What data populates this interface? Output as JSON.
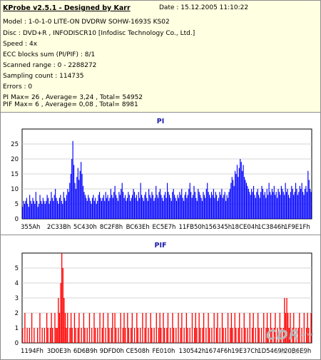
{
  "header": {
    "title": "KProbe v2.5.1 - Designed by Karr",
    "date": "Date : 15.12.2005 11:10:22",
    "lines": [
      "Model : 1-0-1-0 LITE-ON DVDRW SOHW-1693S KS02",
      "Disc : DVD+R , INFODISCR10 [Infodisc Technology Co., Ltd.]",
      "Speed : 4x",
      "ECC blocks sum (PI/PIF) : 8/1",
      "Scanned range : 0 - 2288272",
      "Sampling count : 114735",
      "Errors : 0",
      "PI Max= 26 , Average= 3,24 , Total= 54952",
      "PIF Max= 6 , Average= 0,08 , Total= 8981"
    ]
  },
  "colors": {
    "pi_bars": "#0000ff",
    "pif_bars": "#ff0000",
    "title": "#1a1aa8",
    "info_bg": "#ffffe1"
  },
  "watermark": {
    "logo": "CDR",
    "server": "server",
    "url": "www.cdr.cz"
  },
  "chart_data": [
    {
      "type": "bar",
      "title": "PI",
      "ylim": [
        0,
        30
      ],
      "yticks": [
        0,
        5,
        10,
        15,
        20,
        25
      ],
      "xtick_labels": [
        "355Ah",
        "2C33Bh",
        "5C430h",
        "8C2F8h",
        "BC63Eh",
        "EC5E7h",
        "11FB50h",
        "156345h",
        "18CE04h",
        "1C3846h",
        "1F9E1Fh"
      ],
      "grid": true,
      "series": [
        {
          "values": [
            4,
            6,
            5,
            6,
            7,
            5,
            4,
            8,
            6,
            5,
            7,
            6,
            5,
            9,
            6,
            4,
            5,
            8,
            6,
            5,
            7,
            6,
            5,
            6,
            8,
            7,
            5,
            6,
            9,
            7,
            6,
            8,
            10,
            7,
            6,
            5,
            7,
            8,
            6,
            5,
            9,
            7,
            6,
            8,
            10,
            9,
            12,
            15,
            20,
            26,
            18,
            12,
            10,
            14,
            17,
            13,
            16,
            19,
            15,
            11,
            9,
            8,
            7,
            6,
            8,
            7,
            6,
            5,
            7,
            8,
            6,
            7,
            5,
            6,
            8,
            9,
            7,
            6,
            7,
            8,
            6,
            9,
            7,
            8,
            6,
            7,
            10,
            8,
            7,
            9,
            11,
            8,
            7,
            6,
            9,
            8,
            10,
            12,
            9,
            7,
            8,
            6,
            7,
            9,
            8,
            6,
            7,
            8,
            10,
            9,
            7,
            8,
            6,
            9,
            7,
            12,
            8,
            7,
            6,
            8,
            9,
            7,
            6,
            10,
            8,
            7,
            9,
            8,
            6,
            7,
            11,
            8,
            7,
            9,
            10,
            8,
            7,
            6,
            8,
            9,
            7,
            12,
            9,
            8,
            7,
            6,
            9,
            10,
            8,
            7,
            6,
            8,
            7,
            9,
            8,
            10,
            7,
            6,
            8,
            9,
            7,
            8,
            10,
            12,
            9,
            7,
            8,
            11,
            9,
            7,
            6,
            10,
            9,
            8,
            7,
            6,
            9,
            8,
            7,
            10,
            12,
            9,
            8,
            7,
            9,
            8,
            10,
            7,
            9,
            8,
            6,
            7,
            9,
            8,
            10,
            7,
            8,
            9,
            6,
            8,
            7,
            9,
            10,
            12,
            14,
            13,
            11,
            16,
            15,
            18,
            14,
            17,
            20,
            19,
            16,
            18,
            14,
            13,
            12,
            11,
            10,
            9,
            8,
            10,
            9,
            11,
            8,
            7,
            9,
            10,
            8,
            7,
            9,
            11,
            10,
            8,
            9,
            7,
            10,
            8,
            12,
            9,
            8,
            10,
            9,
            11,
            8,
            9,
            7,
            10,
            9,
            8,
            11,
            10,
            9,
            8,
            12,
            9,
            10,
            8,
            7,
            9,
            11,
            10,
            8,
            9,
            12,
            10,
            8,
            9,
            11,
            10,
            12,
            9,
            8,
            10,
            11,
            9,
            16,
            13,
            10,
            9
          ]
        }
      ]
    },
    {
      "type": "bar",
      "title": "PIF",
      "ylim": [
        0,
        6
      ],
      "yticks": [
        0,
        1,
        2,
        3,
        4,
        5
      ],
      "xtick_labels": [
        "1194Fh",
        "3D0E3h",
        "6D6B9h",
        "9DFD0h",
        "CE508h",
        "FE010h",
        "130542h",
        "1674F6h",
        "19E37Ch",
        "1D5469h",
        "20B6E9h"
      ],
      "grid": true,
      "series": [
        {
          "values": [
            1,
            0,
            2,
            0,
            1,
            0,
            1,
            0,
            2,
            0,
            1,
            0,
            0,
            1,
            0,
            2,
            0,
            1,
            0,
            1,
            0,
            2,
            1,
            0,
            1,
            2,
            1,
            0,
            2,
            1,
            1,
            3,
            2,
            4,
            6,
            5,
            3,
            2,
            1,
            2,
            0,
            1,
            2,
            1,
            0,
            2,
            1,
            0,
            1,
            2,
            0,
            1,
            0,
            2,
            1,
            0,
            1,
            0,
            2,
            0,
            1,
            0,
            2,
            1,
            0,
            1,
            0,
            2,
            0,
            1,
            2,
            0,
            1,
            0,
            2,
            1,
            0,
            1,
            2,
            0,
            2,
            1,
            0,
            1,
            0,
            2,
            0,
            1,
            2,
            1,
            0,
            2,
            1,
            0,
            1,
            2,
            0,
            1,
            0,
            2,
            1,
            0,
            1,
            0,
            2,
            0,
            1,
            2,
            0,
            1,
            0,
            2,
            1,
            0,
            1,
            0,
            2,
            0,
            1,
            2,
            1,
            0,
            2,
            1,
            0,
            1,
            2,
            0,
            1,
            0,
            2,
            1,
            0,
            1,
            0,
            2,
            0,
            1,
            2,
            0,
            1,
            0,
            2,
            1,
            0,
            1,
            0,
            2,
            0,
            1,
            2,
            1,
            0,
            2,
            1,
            0,
            1,
            2,
            0,
            1,
            0,
            2,
            1,
            0,
            1,
            0,
            2,
            0,
            1,
            2,
            0,
            1,
            0,
            2,
            1,
            0,
            1,
            0,
            2,
            0,
            1,
            2,
            1,
            0,
            2,
            1,
            0,
            1,
            2,
            0,
            1,
            0,
            2,
            1,
            0,
            1,
            0,
            2,
            0,
            1,
            2,
            0,
            1,
            0,
            2,
            1,
            0,
            1,
            0,
            2,
            0,
            1,
            2,
            1,
            0,
            2,
            1,
            0,
            1,
            2,
            0,
            1,
            0,
            2,
            1,
            0,
            1,
            3,
            2,
            3,
            2,
            1,
            2,
            0,
            1,
            2,
            0,
            1,
            0,
            1,
            2,
            0,
            1,
            0,
            2,
            0,
            1,
            2,
            1,
            0,
            2
          ]
        }
      ]
    }
  ]
}
